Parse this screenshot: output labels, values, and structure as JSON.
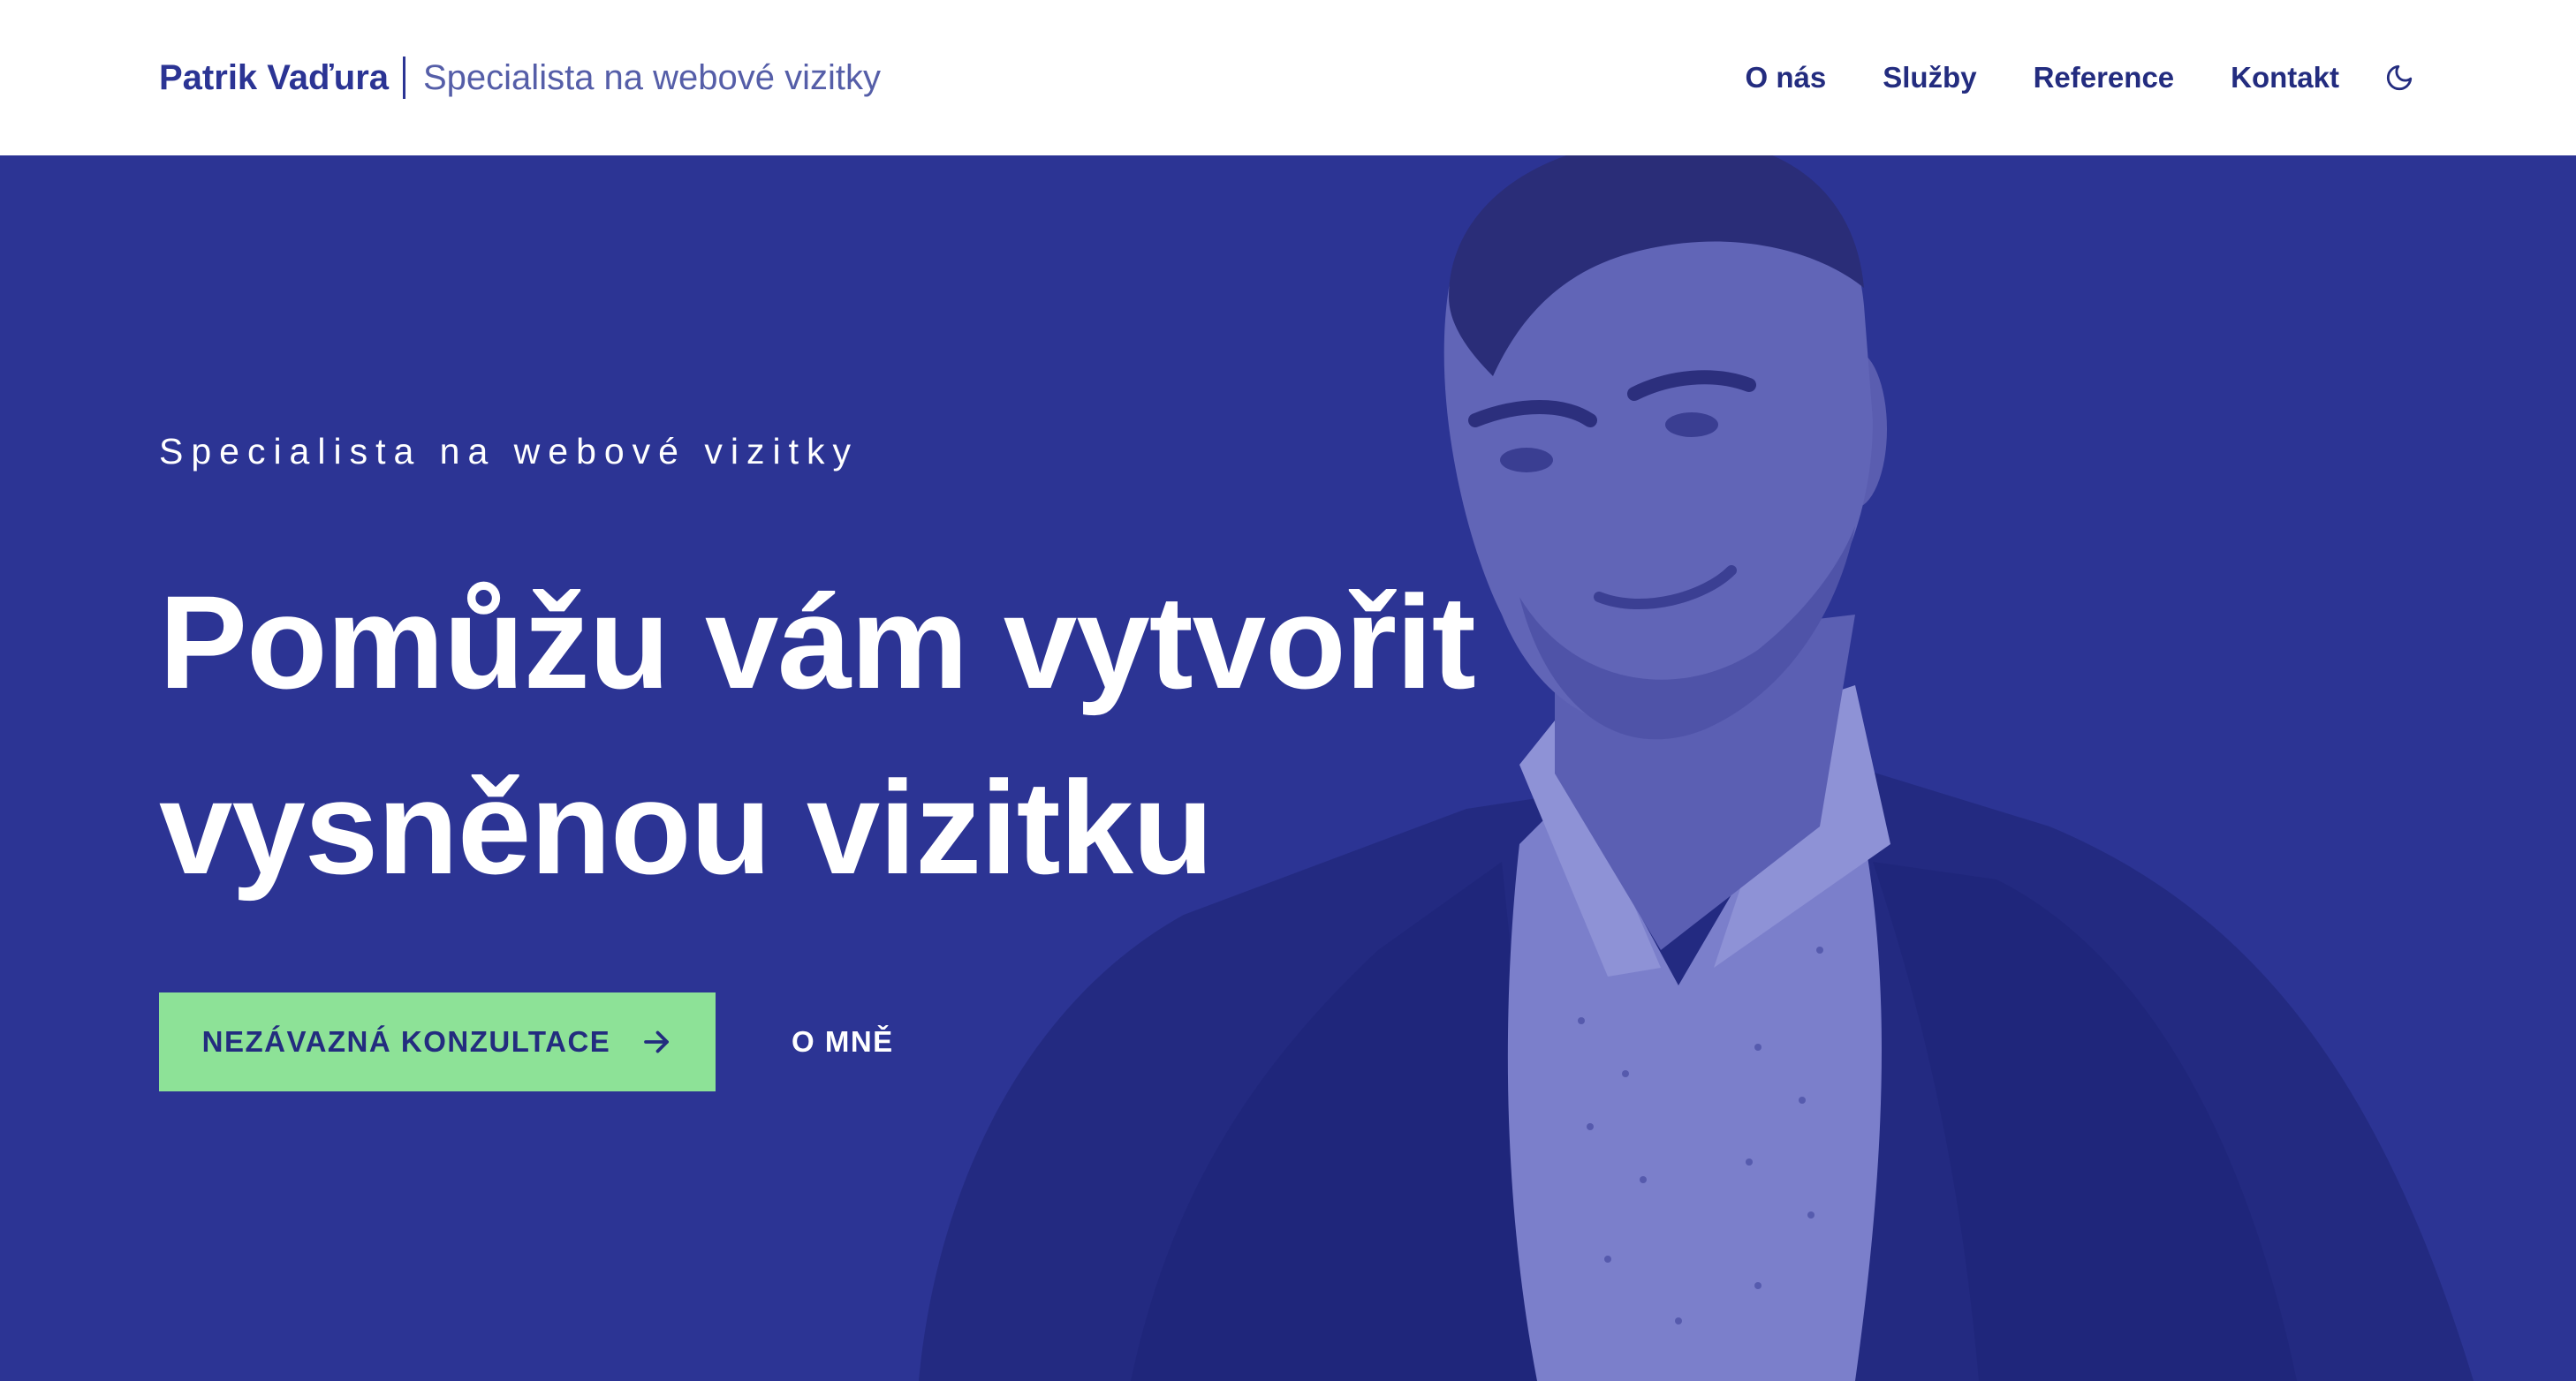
{
  "header": {
    "brand_name": "Patrik Vaďura",
    "brand_tagline": "Specialista na webové vizitky",
    "nav": [
      {
        "label": "O nás"
      },
      {
        "label": "Služby"
      },
      {
        "label": "Reference"
      },
      {
        "label": "Kontakt"
      }
    ],
    "theme_icon": "moon-icon"
  },
  "hero": {
    "eyebrow": "Specialista na webové vizitky",
    "headline": "Pomůžu vám vytvořit vysněnou vizitku",
    "primary_cta": "NEZÁVAZNÁ KONZULTACE",
    "primary_cta_icon": "arrow-right-icon",
    "secondary_cta": "O MNĚ",
    "photo_alt": "portrait-photo"
  },
  "colors": {
    "brand": "#2b3494",
    "hero_background": "#2c3494",
    "cta_green": "#8de297",
    "white": "#ffffff"
  }
}
